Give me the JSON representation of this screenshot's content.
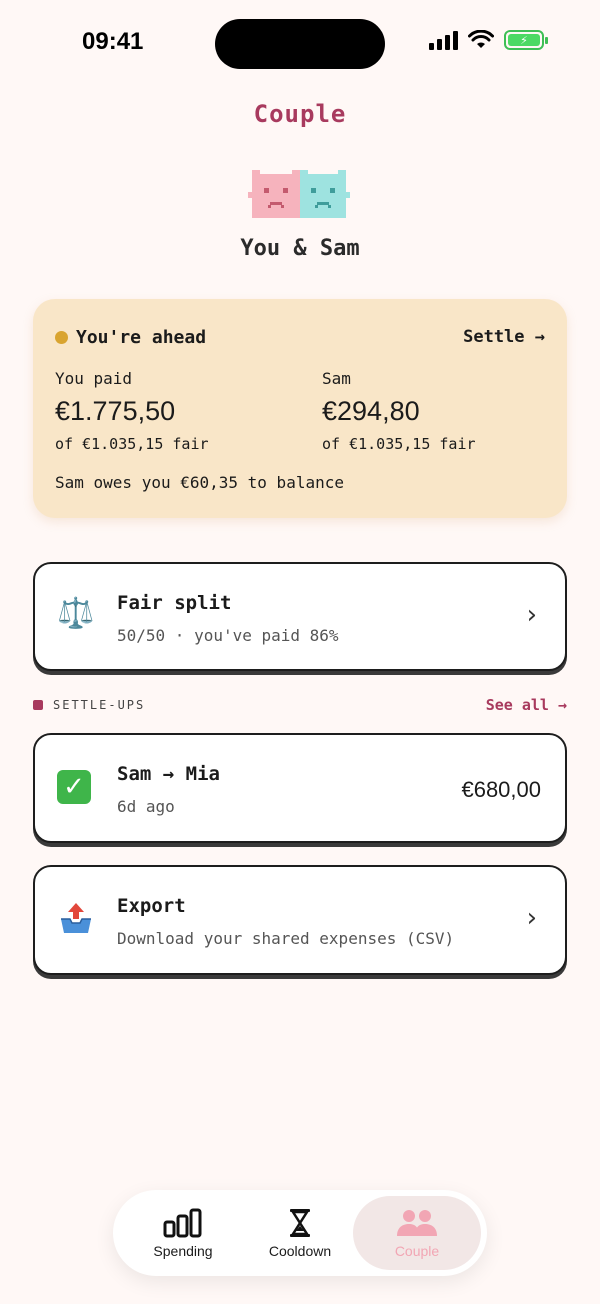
{
  "status": {
    "time": "09:41"
  },
  "header": {
    "title": "Couple",
    "pair_name": "You & Sam"
  },
  "balance": {
    "status": "You're ahead",
    "settle": "Settle →",
    "you_label": "You paid",
    "you_amount": "€1.775,50",
    "you_fair": "of €1.035,15 fair",
    "partner_label": "Sam",
    "partner_amount": "€294,80",
    "partner_fair": "of €1.035,15 fair",
    "owes": "Sam owes you €60,35 to balance",
    "dot_color": "#d9a430"
  },
  "fair_split": {
    "title": "Fair split",
    "sub": "50/50 · you've paid 86%",
    "icon": "scales-icon"
  },
  "settle_ups": {
    "label": "SETTLE-UPS",
    "see_all": "See all →",
    "items": [
      {
        "title": "Sam → Mia",
        "time": "6d ago",
        "amount": "€680,00",
        "icon": "check-icon"
      }
    ]
  },
  "export": {
    "title": "Export",
    "sub": "Download your shared expenses (CSV)",
    "icon": "outbox-tray-icon"
  },
  "tabs": [
    {
      "label": "Spending",
      "icon": "bar-chart-icon",
      "active": false
    },
    {
      "label": "Cooldown",
      "icon": "hourglass-icon",
      "active": false
    },
    {
      "label": "Couple",
      "icon": "people-icon",
      "active": true
    }
  ],
  "colors": {
    "accent": "#a83a5e",
    "card_bg": "#f9e6c8",
    "page_bg": "#fff8f6",
    "active_tab": "#f2a6b4"
  }
}
